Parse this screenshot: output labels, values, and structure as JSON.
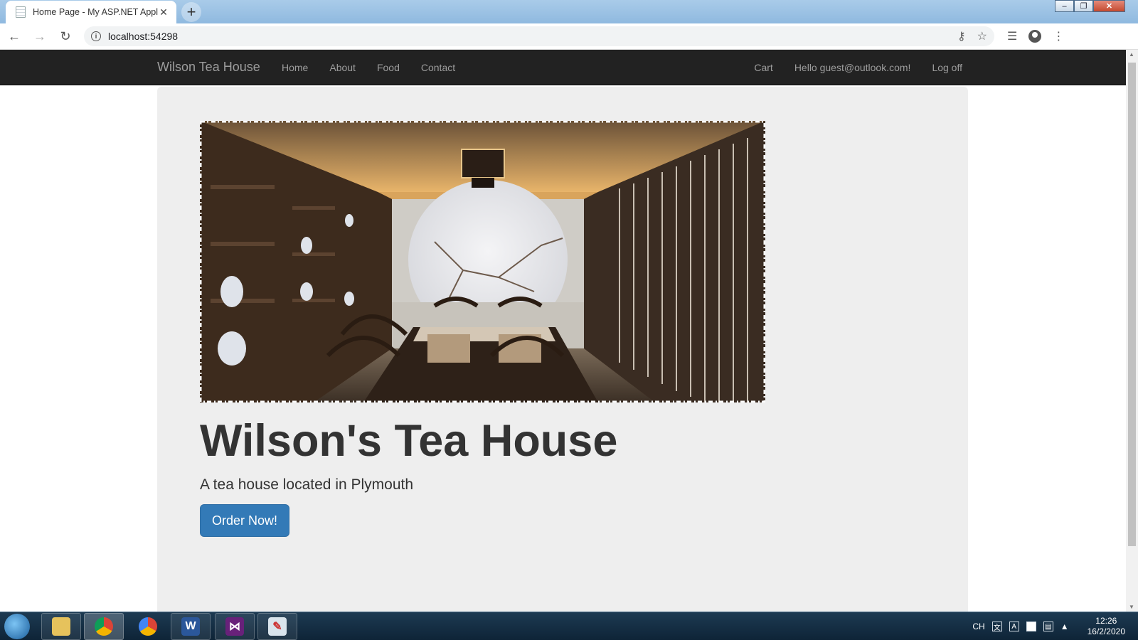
{
  "browser": {
    "tab_title": "Home Page - My ASP.NET Applic",
    "url": "localhost:54298"
  },
  "navbar": {
    "brand": "Wilson Tea House",
    "left_links": [
      "Home",
      "About",
      "Food",
      "Contact"
    ],
    "right_links": [
      "Cart",
      "Hello guest@outlook.com!",
      "Log off"
    ]
  },
  "jumbotron": {
    "title": "Wilson's Tea House",
    "subtitle": "A tea house located in Plymouth",
    "button_label": "Order Now!"
  },
  "taskbar": {
    "apps": [
      "file-explorer",
      "chrome",
      "chrome-canary",
      "word",
      "visual-studio",
      "paint"
    ],
    "tray_lang": "CH",
    "time": "12:26",
    "date": "16/2/2020"
  },
  "colors": {
    "navbar_bg": "#222222",
    "jumbotron_bg": "#eeeeee",
    "button_bg": "#337ab7"
  }
}
